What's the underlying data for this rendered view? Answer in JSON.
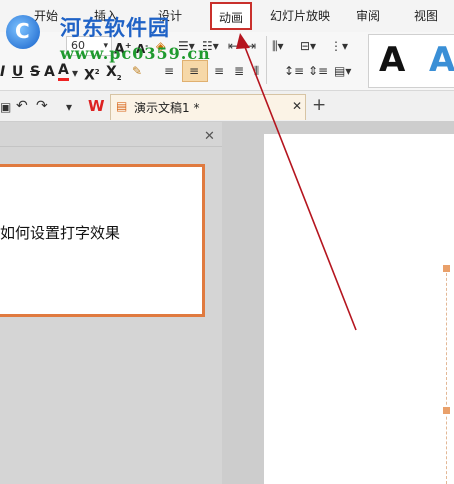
{
  "menu": {
    "tabs": [
      "开始",
      "插入",
      "设计",
      "动画",
      "幻灯片放映",
      "审阅",
      "视图"
    ],
    "highlighted": "动画"
  },
  "watermark": {
    "title": "河东软件园",
    "url": "www.pc0359.cn"
  },
  "ribbon": {
    "font_size": "60",
    "style_preview": [
      "A",
      "A"
    ]
  },
  "document": {
    "tab_title": "演示文稿1 *"
  },
  "slide": {
    "text": "如何设置打字效果"
  },
  "colors": {
    "highlight": "#c9302c",
    "arrow": "#b5151f",
    "thumb_border": "#e07a3f",
    "accent_blue": "#3a8fd6"
  },
  "icons": {
    "undo": "undo-icon",
    "redo": "redo-icon",
    "wps": "wps-logo-icon",
    "close": "close-icon",
    "new_tab": "plus-icon"
  }
}
